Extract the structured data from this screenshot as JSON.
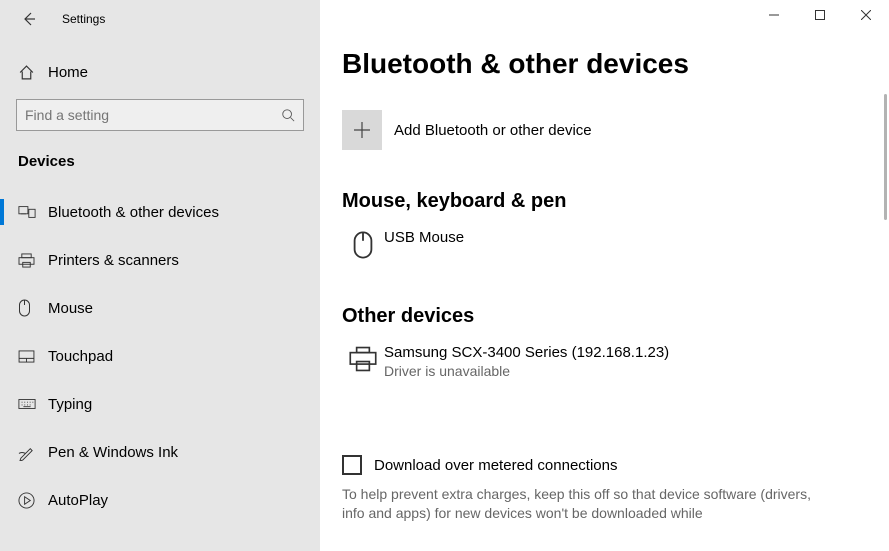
{
  "window": {
    "title": "Settings"
  },
  "sidebar": {
    "home_label": "Home",
    "search_placeholder": "Find a setting",
    "section_label": "Devices",
    "items": [
      {
        "label": "Bluetooth & other devices",
        "selected": true
      },
      {
        "label": "Printers & scanners"
      },
      {
        "label": "Mouse"
      },
      {
        "label": "Touchpad"
      },
      {
        "label": "Typing"
      },
      {
        "label": "Pen & Windows Ink"
      },
      {
        "label": "AutoPlay"
      }
    ]
  },
  "page": {
    "title": "Bluetooth & other devices",
    "add_device_label": "Add Bluetooth or other device",
    "group1_title": "Mouse, keyboard & pen",
    "device1_name": "USB Mouse",
    "group2_title": "Other devices",
    "device2_name": "Samsung SCX-3400 Series (192.168.1.23)",
    "device2_status": "Driver is unavailable",
    "metered_checkbox_label": "Download over metered connections",
    "metered_help": "To help prevent extra charges, keep this off so that device software (drivers, info and apps) for new devices won't be downloaded while"
  }
}
